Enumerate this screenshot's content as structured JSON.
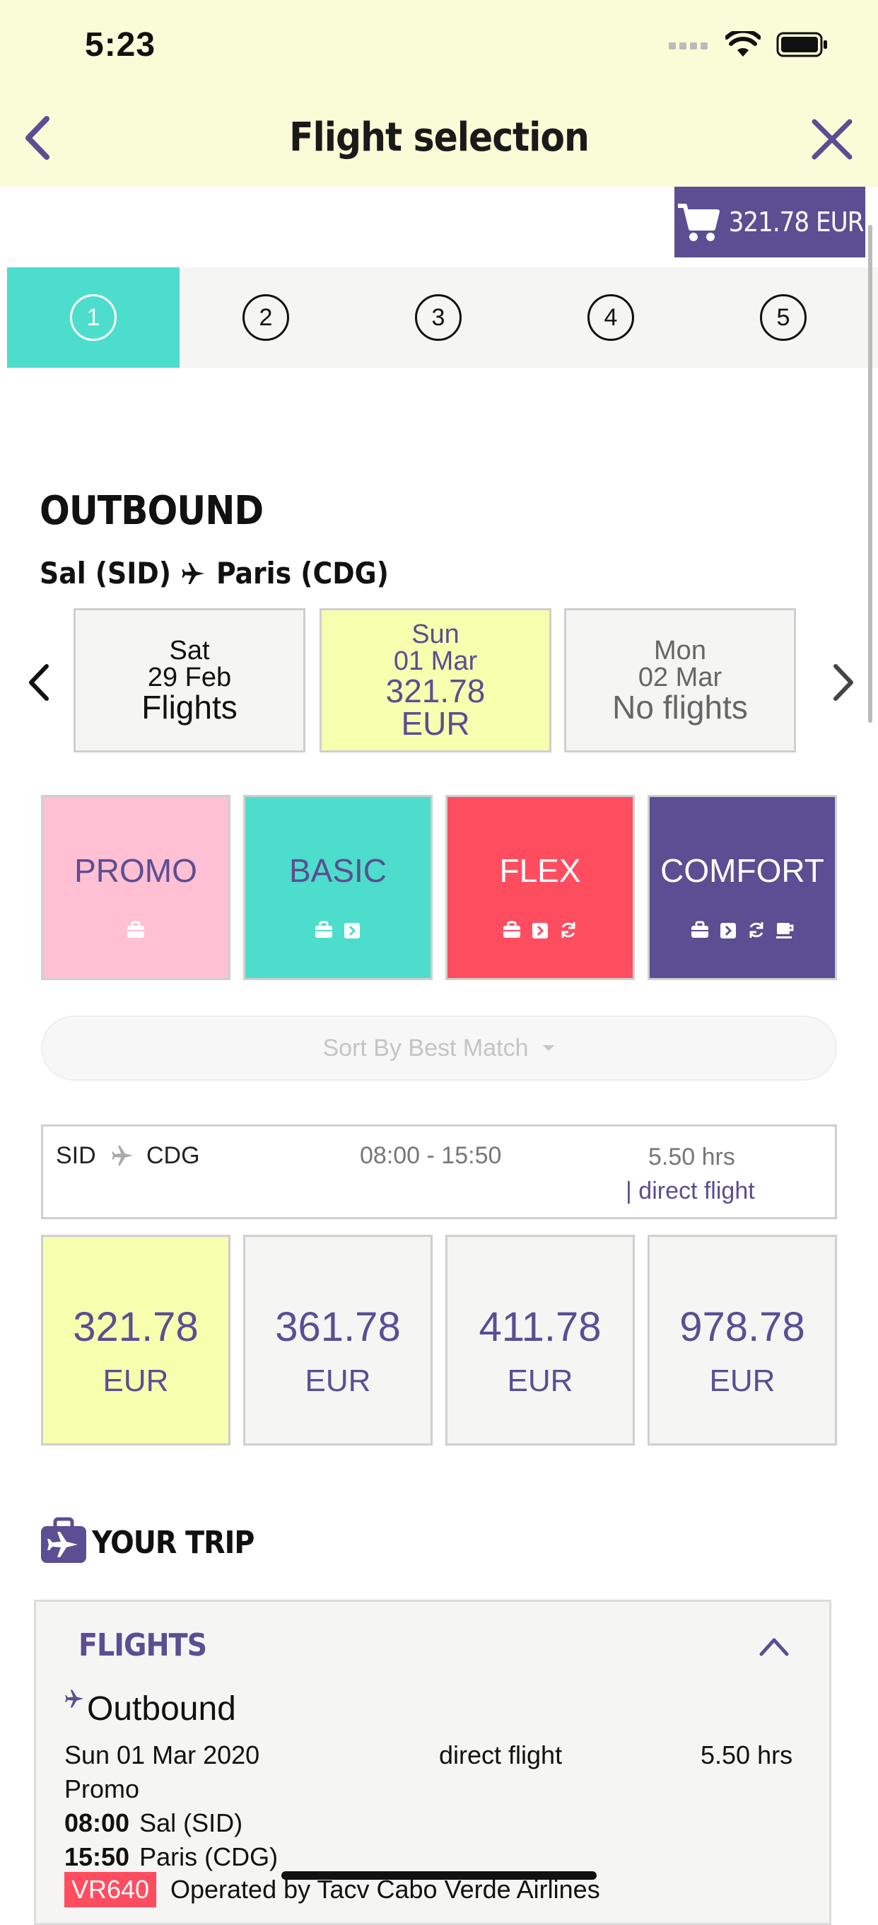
{
  "status_bar": {
    "time": "5:23"
  },
  "header": {
    "title": "Flight selection"
  },
  "cart": {
    "amount": "321.78 EUR"
  },
  "steps": [
    "1",
    "2",
    "3",
    "4",
    "5"
  ],
  "outbound": {
    "heading": "OUTBOUND",
    "origin": "Sal (SID)",
    "destination": "Paris (CDG)"
  },
  "dates": [
    {
      "day": "Sat",
      "date": "29 Feb",
      "info": "Flights",
      "extra": ""
    },
    {
      "day": "Sun",
      "date": "01 Mar",
      "info": "321.78",
      "extra": "EUR"
    },
    {
      "day": "Mon",
      "date": "02 Mar",
      "info": "No flights",
      "extra": ""
    }
  ],
  "fares": [
    {
      "name": "PROMO",
      "color": "#ffc0d3",
      "text_color": "#5b4e92"
    },
    {
      "name": "BASIC",
      "color": "#4dddcc",
      "text_color": "#5b4e92"
    },
    {
      "name": "FLEX",
      "color": "#ff4d60",
      "text_color": "#ffffff"
    },
    {
      "name": "COMFORT",
      "color": "#5b4e92",
      "text_color": "#ffffff"
    }
  ],
  "sort": {
    "label": "Sort By Best Match"
  },
  "flight": {
    "from": "SID",
    "to": "CDG",
    "times": "08:00 - 15:50",
    "duration": "5.50 hrs",
    "type": "| direct flight"
  },
  "prices": [
    {
      "value": "321.78",
      "currency": "EUR"
    },
    {
      "value": "361.78",
      "currency": "EUR"
    },
    {
      "value": "411.78",
      "currency": "EUR"
    },
    {
      "value": "978.78",
      "currency": "EUR"
    }
  ],
  "trip": {
    "title": "YOUR TRIP",
    "flights_heading": "FLIGHTS",
    "outbound_label": "Outbound",
    "date": "Sun 01 Mar 2020",
    "type": "direct flight",
    "duration": "5.50 hrs",
    "fare": "Promo",
    "dep_time": "08:00",
    "dep_place": "Sal (SID)",
    "arr_time": "15:50",
    "arr_place": "Paris (CDG)",
    "flight_no": "VR640",
    "operated": "Operated by Tacv Cabo Verde Airlines"
  },
  "colors": {
    "header_bg": "#fafcd7",
    "brand_purple": "#5b4e92",
    "teal": "#4dddcc",
    "selected_yellow": "#f7ffaf",
    "red": "#ff4d60"
  }
}
